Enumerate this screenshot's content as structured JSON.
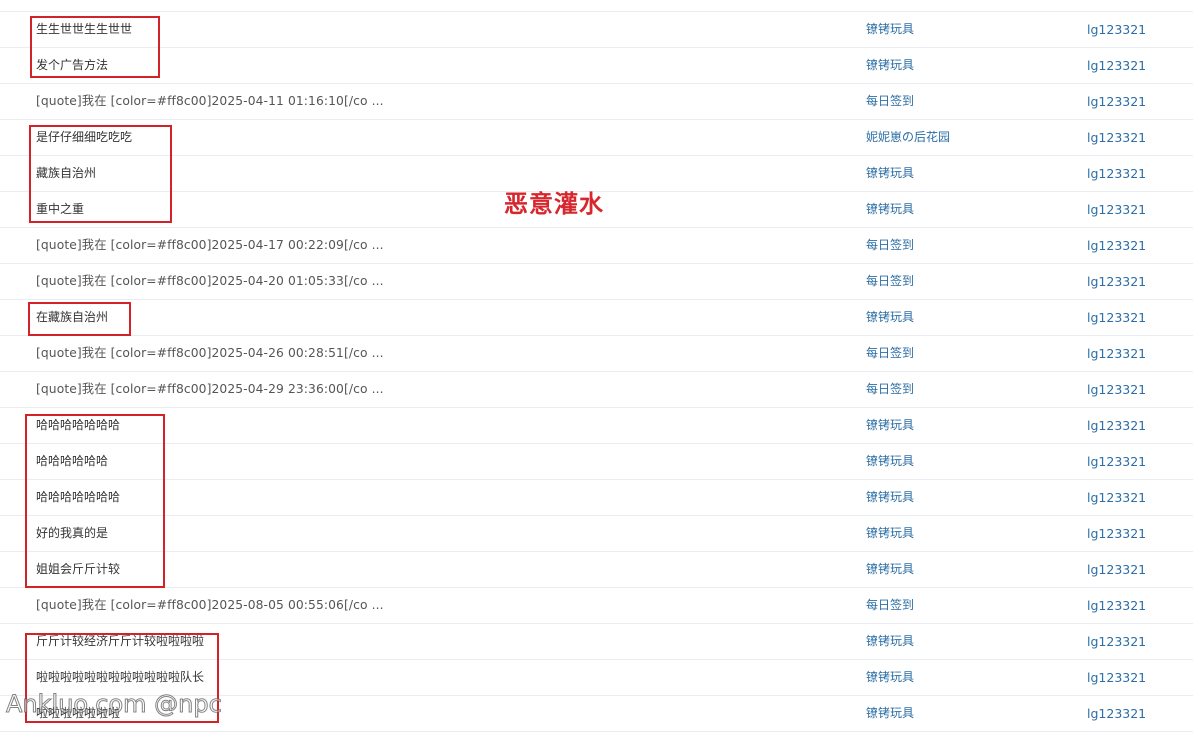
{
  "rows": [
    {
      "title": "生生世世生生世世",
      "forum": "镣铐玩具",
      "author": "lg123321"
    },
    {
      "title": "发个广告方法",
      "forum": "镣铐玩具",
      "author": "lg123321"
    },
    {
      "title": "[quote]我在 [color=#ff8c00]2025-04-11 01:16:10[/co ...",
      "forum": "每日签到",
      "author": "lg123321"
    },
    {
      "title": "是仔仔细细吃吃吃",
      "forum": "妮妮崽の后花园",
      "author": "lg123321"
    },
    {
      "title": "藏族自治州",
      "forum": "镣铐玩具",
      "author": "lg123321"
    },
    {
      "title": "重中之重",
      "forum": "镣铐玩具",
      "author": "lg123321"
    },
    {
      "title": "[quote]我在 [color=#ff8c00]2025-04-17 00:22:09[/co ...",
      "forum": "每日签到",
      "author": "lg123321"
    },
    {
      "title": "[quote]我在 [color=#ff8c00]2025-04-20 01:05:33[/co ...",
      "forum": "每日签到",
      "author": "lg123321"
    },
    {
      "title": "在藏族自治州",
      "forum": "镣铐玩具",
      "author": "lg123321"
    },
    {
      "title": "[quote]我在 [color=#ff8c00]2025-04-26 00:28:51[/co ...",
      "forum": "每日签到",
      "author": "lg123321"
    },
    {
      "title": "[quote]我在 [color=#ff8c00]2025-04-29 23:36:00[/co ...",
      "forum": "每日签到",
      "author": "lg123321"
    },
    {
      "title": "哈哈哈哈哈哈哈",
      "forum": "镣铐玩具",
      "author": "lg123321"
    },
    {
      "title": "哈哈哈哈哈哈",
      "forum": "镣铐玩具",
      "author": "lg123321"
    },
    {
      "title": "哈哈哈哈哈哈哈",
      "forum": "镣铐玩具",
      "author": "lg123321"
    },
    {
      "title": "好的我真的是",
      "forum": "镣铐玩具",
      "author": "lg123321"
    },
    {
      "title": "姐姐会斤斤计较",
      "forum": "镣铐玩具",
      "author": "lg123321"
    },
    {
      "title": "[quote]我在 [color=#ff8c00]2025-08-05 00:55:06[/co ...",
      "forum": "每日签到",
      "author": "lg123321"
    },
    {
      "title": "斤斤计较经济斤斤计较啦啦啦啦",
      "forum": "镣铐玩具",
      "author": "lg123321"
    },
    {
      "title": "啦啦啦啦啦啦啦啦啦啦啦啦队长",
      "forum": "镣铐玩具",
      "author": "lg123321"
    },
    {
      "title": "啦啦啦啦啦啦啦",
      "forum": "镣铐玩具",
      "author": "lg123321"
    }
  ],
  "annotation_label": "恶意灌水",
  "watermark": "Ankluo.com @npc",
  "colors": {
    "highlight_box": "#d42328",
    "annotation": "#d7262e",
    "link": "#2c6ea5",
    "row_border": "#e9edf2"
  }
}
